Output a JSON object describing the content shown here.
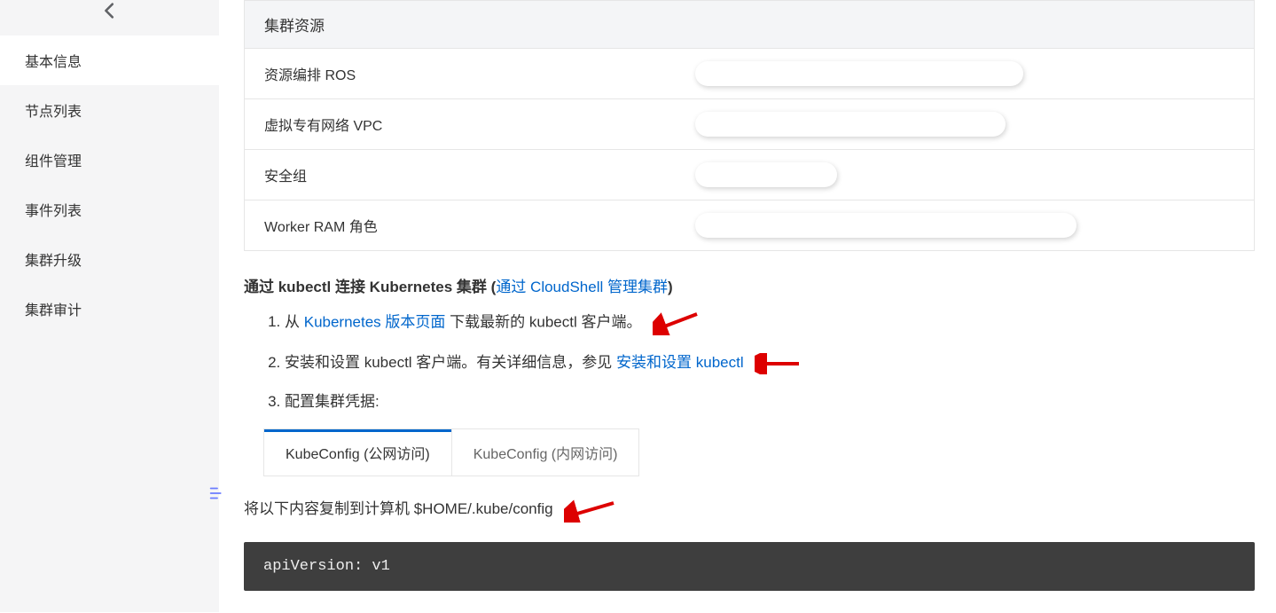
{
  "sidebar": {
    "items": [
      {
        "label": "基本信息",
        "active": true
      },
      {
        "label": "节点列表",
        "active": false
      },
      {
        "label": "组件管理",
        "active": false
      },
      {
        "label": "事件列表",
        "active": false
      },
      {
        "label": "集群升级",
        "active": false
      },
      {
        "label": "集群审计",
        "active": false
      }
    ]
  },
  "resources": {
    "header": "集群资源",
    "rows": [
      {
        "label": "资源编排 ROS"
      },
      {
        "label": "虚拟专有网络 VPC"
      },
      {
        "label": "安全组"
      },
      {
        "label": "Worker RAM 角色"
      }
    ]
  },
  "kubectl_section": {
    "title_prefix": "通过 kubectl 连接 Kubernetes 集群 (",
    "title_link": "通过 CloudShell 管理集群",
    "title_suffix": ")",
    "step1_prefix": "从 ",
    "step1_link": "Kubernetes 版本页面",
    "step1_suffix": " 下载最新的 kubectl 客户端。",
    "step2_prefix": "安装和设置 kubectl 客户端。有关详细信息，参见 ",
    "step2_link": "安装和设置 kubectl",
    "step3": "配置集群凭据:"
  },
  "tabs": {
    "public": "KubeConfig (公网访问)",
    "private": "KubeConfig (内网访问)"
  },
  "copy_instruction": "将以下内容复制到计算机 $HOME/.kube/config",
  "code": "apiVersion: v1"
}
